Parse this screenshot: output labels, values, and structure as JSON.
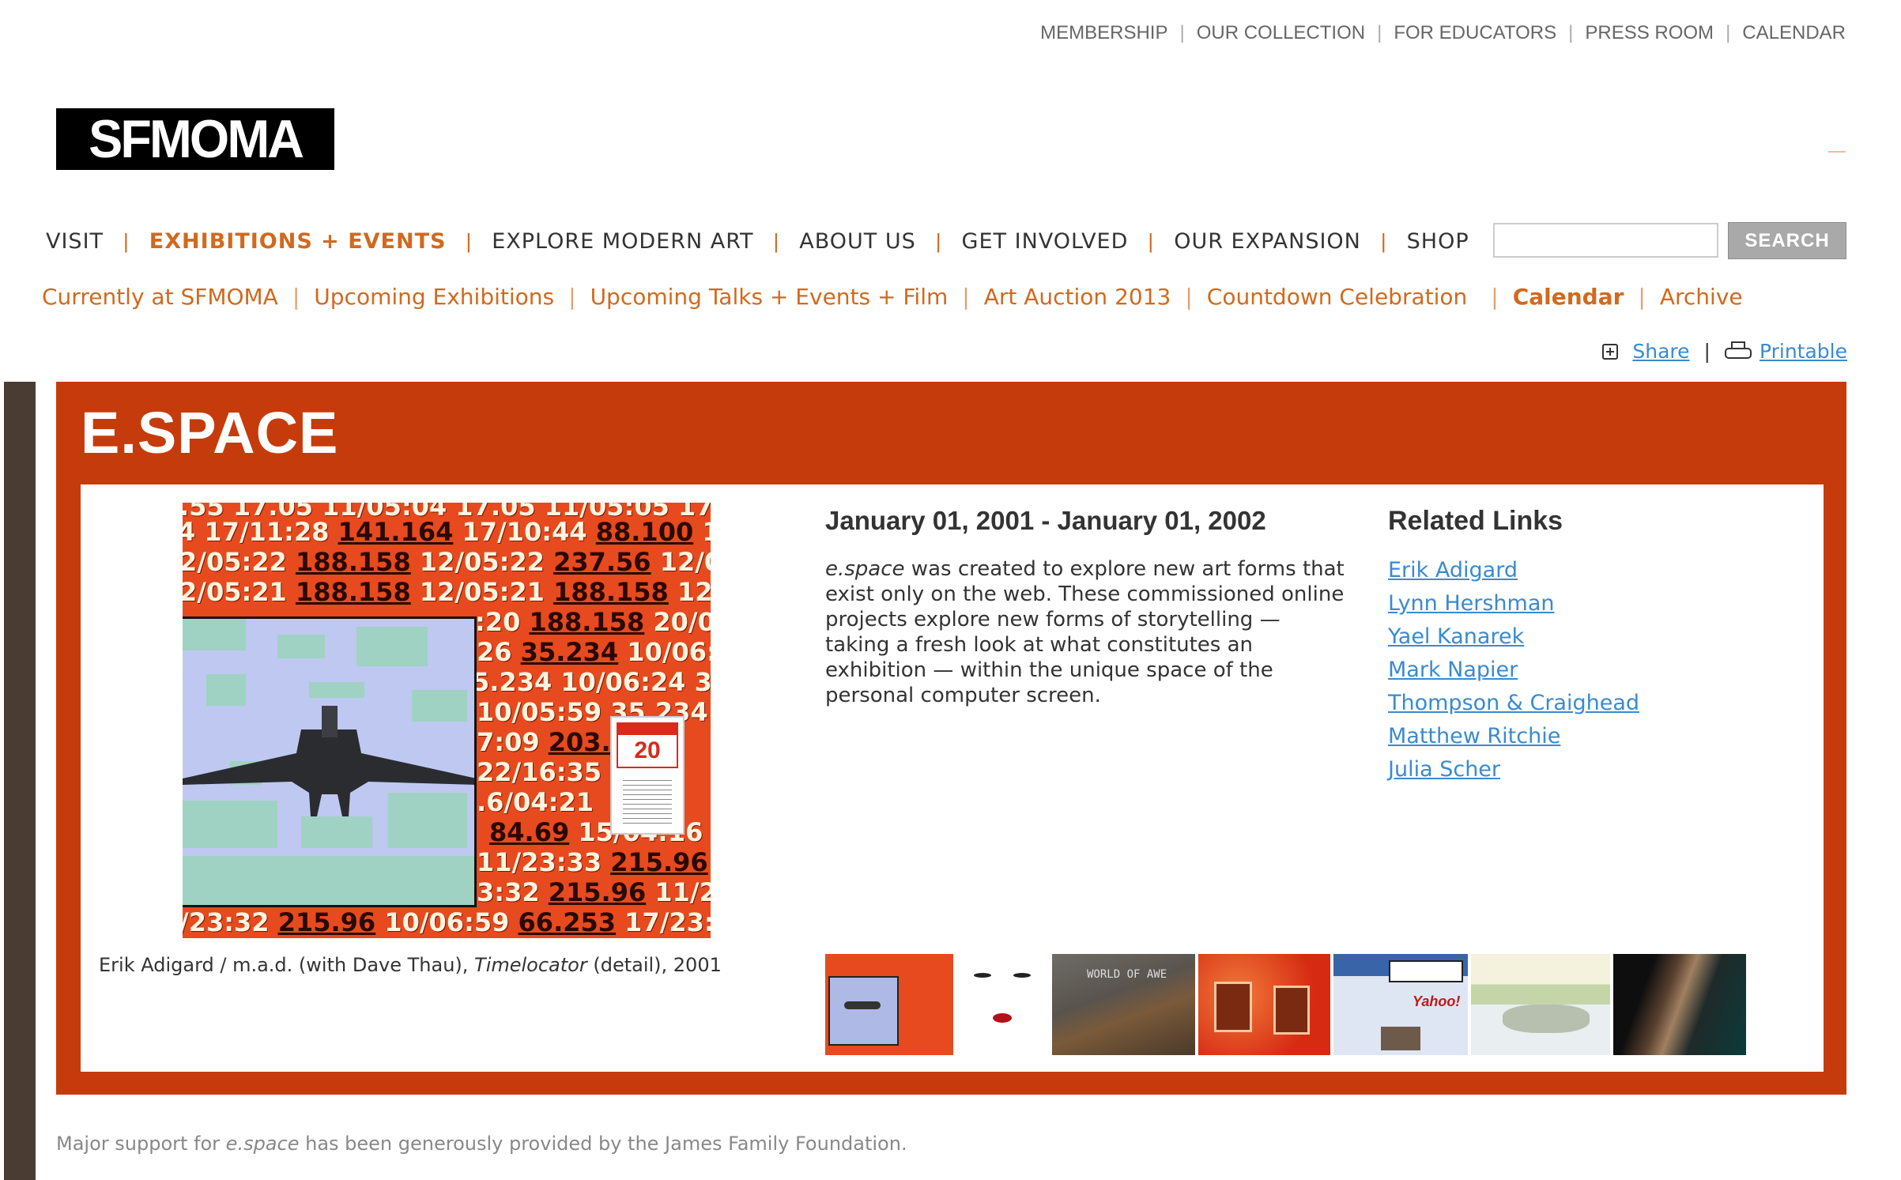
{
  "utility_nav": [
    "MEMBERSHIP",
    "OUR COLLECTION",
    "FOR EDUCATORS",
    "PRESS ROOM",
    "CALENDAR"
  ],
  "logo_text": "SFMOMA",
  "main_nav": {
    "items": [
      "VISIT",
      "EXHIBITIONS + EVENTS",
      "EXPLORE MODERN ART",
      "ABOUT US",
      "GET INVOLVED",
      "OUR EXPANSION",
      "SHOP"
    ],
    "active_index": 1
  },
  "search": {
    "button_label": "SEARCH",
    "value": ""
  },
  "sub_nav": {
    "items": [
      "Currently at SFMOMA",
      "Upcoming Exhibitions",
      "Upcoming Talks + Events + Film",
      "Art Auction 2013",
      "Countdown Celebration",
      "Calendar",
      "Archive"
    ],
    "active_index": 5
  },
  "tools": {
    "share": "Share",
    "printable": "Printable"
  },
  "exhibition": {
    "title": "E.SPACE",
    "date_range": "January 01, 2001 - January 01, 2002",
    "description_em": "e.space",
    "description_rest": " was created to explore new art forms that exist only on the web. These commissioned online projects explore new forms of storytelling — taking a fresh look at what constitutes an exhibition — within the unique space of the personal computer screen.",
    "caption": {
      "before": "Erik Adigard / m.a.d. (with Dave Thau), ",
      "title": "Timelocator",
      "after": " (detail), 2001"
    },
    "artwork_tag_number": "20"
  },
  "related": {
    "title": "Related Links",
    "links": [
      "Erik Adigard",
      "Lynn Hershman",
      "Yael Kanarek",
      "Mark Napier",
      "Thompson & Craighead",
      "Matthew Ritchie",
      "Julia Scher"
    ]
  },
  "thumbnails": [
    "thumb-timelocator",
    "thumb-face",
    "thumb-world-of-awe",
    "thumb-red-frames",
    "thumb-yahoo-browser",
    "thumb-landscape",
    "thumb-dark-abstract"
  ],
  "footer": {
    "before": "Major support for ",
    "em": "e.space",
    "after": " has been generously provided by the James Family Foundation."
  },
  "colors": {
    "accent": "#d2691e",
    "panel": "#c63b0c",
    "link": "#3a8ad0"
  }
}
